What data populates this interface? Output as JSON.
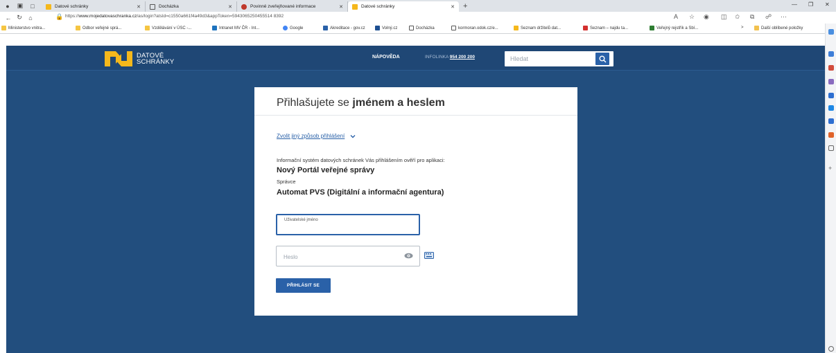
{
  "browser": {
    "tabs": [
      {
        "title": "Datové schránky",
        "active": false
      },
      {
        "title": "Docházka",
        "active": false
      },
      {
        "title": "Povinně zveřejňované informace",
        "active": false
      },
      {
        "title": "Datové schránky",
        "active": true
      }
    ],
    "new_tab_label": "+",
    "url_prefix": "https://",
    "url_host": "www.mojedatovaschranka.cz",
    "url_path": "/as/login?atsId=c1550a661f4a49d3&appToken=5943065250455514 8392",
    "url_full": "https://www.mojedatovaschranka.cz/as/login?atsId=c1550a661f4a49d3&appToken=59430652504555148392",
    "favorites": [
      "Ministerstvo vnitra...",
      "Odbor veřejné sprá...",
      "Vzdělávání v ÚSC -...",
      "Intranet MV ČR - Int...",
      "Google",
      "Akreditace - gov.cz",
      "Volný.cz",
      "Docházka",
      "kormoran.odok.cz/e...",
      "Seznam držitelů dat...",
      "Seznam – najdu ta...",
      "Veřejný rejstřík a Sbí...",
      ">",
      "Další oblíbené položky"
    ]
  },
  "header": {
    "logo_line1": "DATOVÉ",
    "logo_line2": "SCHRÁNKY",
    "help_label": "NÁPOVĚDA",
    "infoline_label": "INFOLINKA",
    "infoline_number": "954 200 200",
    "search_placeholder": "Hledat"
  },
  "login": {
    "title_prefix": "Přihlašujete se ",
    "title_bold": "jménem a heslem",
    "alt_login_label": "Zvolit jiný způsob přihlášení",
    "info_text": "Informační systém datových schránek Vás přihlášením ověří pro aplikaci:",
    "app_name": "Nový Portál veřejné správy",
    "admin_label": "Správce",
    "admin_name": "Automat PVS (Digitální a informační agentura)",
    "username_label": "Uživatelské jméno",
    "username_value": "",
    "password_placeholder": "Heslo",
    "submit_label": "PŘIHLÁSIT SE"
  },
  "colors": {
    "page_bg": "#224e7e",
    "header_bg": "#1f4775",
    "accent": "#2a61a8",
    "logo_yellow": "#f5b81c"
  },
  "icons": {
    "search": "search-icon",
    "eye": "eye-icon",
    "keyboard": "keyboard-icon",
    "chevron": "chevron-down-icon"
  }
}
